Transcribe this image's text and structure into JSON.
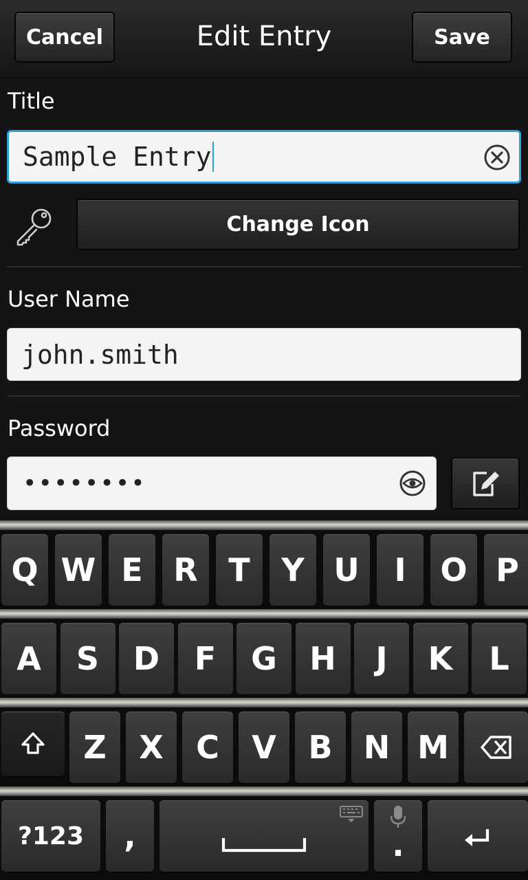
{
  "titlebar": {
    "cancel_label": "Cancel",
    "title": "Edit Entry",
    "save_label": "Save"
  },
  "form": {
    "title_label": "Title",
    "title_value": "Sample Entry",
    "change_icon_label": "Change Icon",
    "username_label": "User Name",
    "username_value": "john.smith",
    "password_label": "Password",
    "password_value": "••••••••"
  },
  "keyboard": {
    "row1": [
      "Q",
      "W",
      "E",
      "R",
      "T",
      "Y",
      "U",
      "I",
      "O",
      "P"
    ],
    "row2": [
      "A",
      "S",
      "D",
      "F",
      "G",
      "H",
      "J",
      "K",
      "L"
    ],
    "row3": [
      "Z",
      "X",
      "C",
      "V",
      "B",
      "N",
      "M"
    ],
    "symbols_label": "?123",
    "comma": ",",
    "period": "."
  },
  "colors": {
    "focus_accent": "#2ea1d8",
    "background": "#141414",
    "field_bg": "#f4f4f4"
  },
  "icons": [
    "clear-icon",
    "key-icon",
    "eye-icon",
    "edit-icon",
    "shift-icon",
    "backspace-icon",
    "keyboard-icon",
    "microphone-icon",
    "enter-icon",
    "space-bar-icon"
  ]
}
